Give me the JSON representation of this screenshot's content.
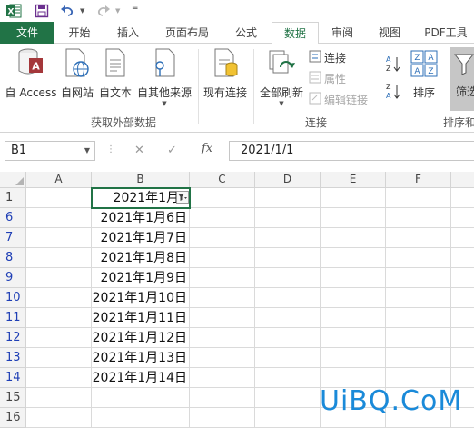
{
  "colors": {
    "excel_green": "#217346",
    "filtered_row": "#1f3fb5",
    "watermark": "#1a8ad9"
  },
  "titlebar": {
    "icons": [
      "excel-logo-icon",
      "save-icon",
      "undo-icon",
      "redo-icon",
      "customize-qat-icon"
    ]
  },
  "tabs": [
    {
      "label": "文件"
    },
    {
      "label": "开始"
    },
    {
      "label": "插入"
    },
    {
      "label": "页面布局"
    },
    {
      "label": "公式"
    },
    {
      "label": "数据"
    },
    {
      "label": "审阅"
    },
    {
      "label": "视图"
    },
    {
      "label": "PDF工具"
    }
  ],
  "active_tab": "数据",
  "ribbon": {
    "get_external": {
      "buttons": [
        {
          "label": "自 Access",
          "icon": "access-db-icon"
        },
        {
          "label": "自网站",
          "icon": "web-icon"
        },
        {
          "label": "自文本",
          "icon": "text-file-icon"
        },
        {
          "label": "自其他来源",
          "icon": "other-sources-icon"
        }
      ],
      "group_label": "获取外部数据"
    },
    "existing": {
      "label": "现有连接",
      "icon": "existing-connections-icon"
    },
    "connections": {
      "refresh_label": "全部刷新",
      "items": [
        {
          "label": "连接",
          "disabled": false
        },
        {
          "label": "属性",
          "disabled": true
        },
        {
          "label": "编辑链接",
          "disabled": true
        }
      ],
      "group_label": "连接"
    },
    "sort": {
      "label": "排序",
      "group_label": "排序和",
      "filter_label": "筛选"
    }
  },
  "formula_bar": {
    "name_box": "B1",
    "formula": "2021/1/1",
    "fx": "fx"
  },
  "sheet": {
    "columns": [
      "A",
      "B",
      "C",
      "D",
      "E",
      "F"
    ],
    "rows": [
      {
        "num": "1",
        "b": "2021年1月1"
      },
      {
        "num": "6",
        "b": "2021年1月6日"
      },
      {
        "num": "7",
        "b": "2021年1月7日"
      },
      {
        "num": "8",
        "b": "2021年1月8日"
      },
      {
        "num": "9",
        "b": "2021年1月9日"
      },
      {
        "num": "10",
        "b": "2021年1月10日"
      },
      {
        "num": "11",
        "b": "2021年1月11日"
      },
      {
        "num": "12",
        "b": "2021年1月12日"
      },
      {
        "num": "13",
        "b": "2021年1月13日"
      },
      {
        "num": "14",
        "b": "2021年1月14日"
      },
      {
        "num": "15",
        "b": ""
      },
      {
        "num": "16",
        "b": ""
      }
    ]
  },
  "watermark": "UiBQ.CoM"
}
